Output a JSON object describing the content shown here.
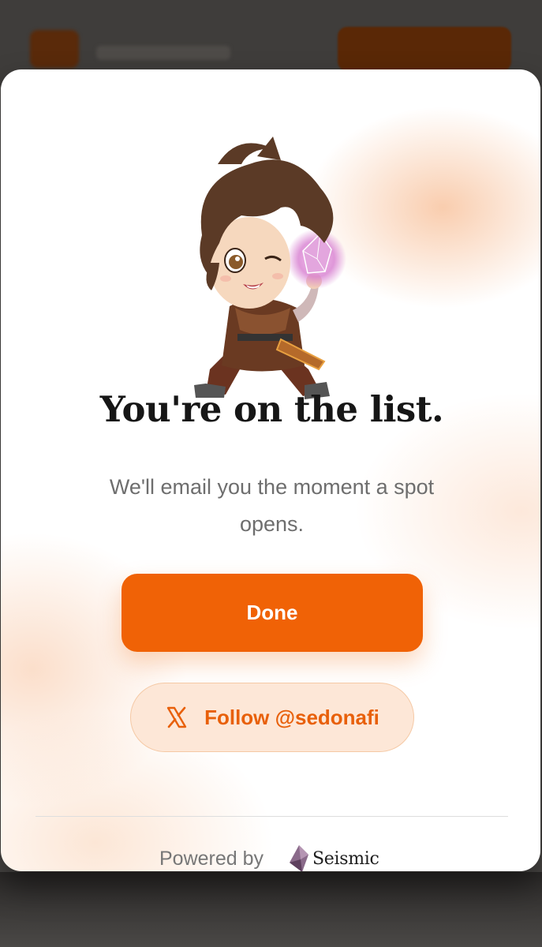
{
  "modal": {
    "title": "You're on the list.",
    "subtitle": "We'll email you the moment a spot opens.",
    "mascot_icon": "chibi-character-with-crystal",
    "done_label": "Done",
    "follow_label": "Follow @sedonafi",
    "follow_icon": "x-logo-icon",
    "powered_by": "Powered by",
    "brand_name": "Seismic",
    "brand_icon": "seismic-logo-icon"
  },
  "colors": {
    "accent": "#f06206",
    "follow_bg": "#fde7d7",
    "follow_text": "#e8600a",
    "title": "#161616",
    "subtitle": "#6e6e6e",
    "brand_purple": "#7a5a7a"
  }
}
